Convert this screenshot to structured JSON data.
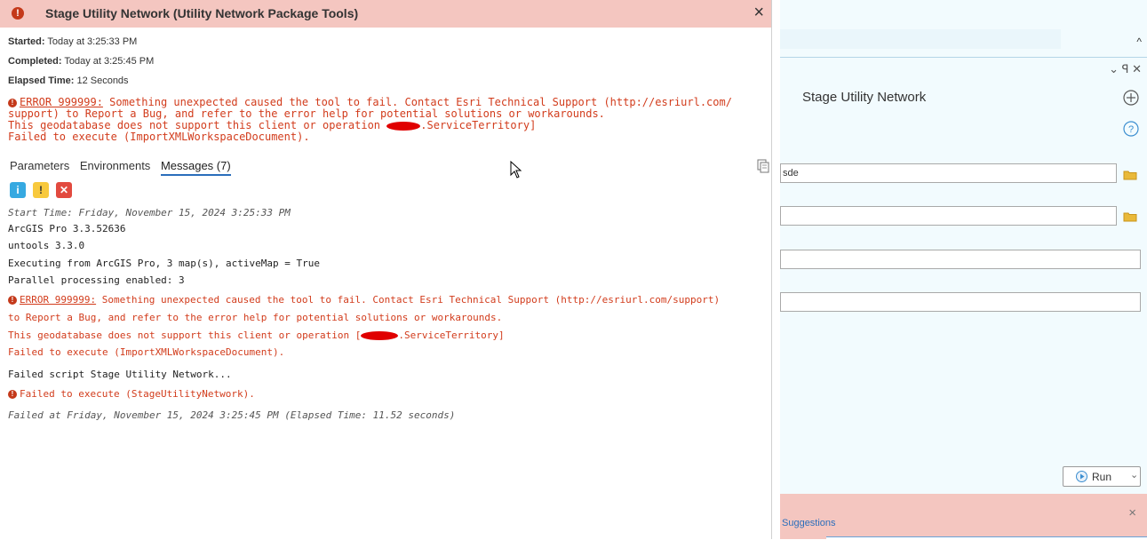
{
  "popup": {
    "title": "Stage Utility Network (Utility Network Package Tools)",
    "close": "×",
    "started_label": "Started:",
    "started_value": "Today at 3:25:33 PM",
    "completed_label": "Completed:",
    "completed_value": "Today at 3:25:45 PM",
    "elapsed_label": "Elapsed Time:",
    "elapsed_value": "12 Seconds",
    "summary_error": {
      "code": "ERROR 999999:",
      "line1": "Something unexpected caused the tool to fail. Contact Esri Technical Support (http://esriurl.com/",
      "line2": "support) to Report a Bug, and refer to the error help for potential solutions or workarounds.",
      "line3_pre": "This geodatabase does not support this client or operation ",
      "line3_post": ".ServiceTerritory]",
      "line4": "Failed to execute (ImportXMLWorkspaceDocument)."
    },
    "tabs": [
      "Parameters",
      "Environments",
      "Messages (7)"
    ],
    "messages": {
      "start_time": "Start Time: Friday, November 15, 2024 3:25:33 PM",
      "version": "ArcGIS Pro 3.3.52636",
      "untools": "untools 3.3.0",
      "executing": "Executing from ArcGIS Pro, 3 map(s), activeMap = True",
      "parallel": "Parallel processing enabled: 3",
      "error_code": "ERROR 999999:",
      "error_line1": "Something unexpected caused the tool to fail. Contact Esri Technical Support (http://esriurl.com/support)",
      "error_line2": "to Report a Bug, and refer to the error help for potential solutions or workarounds.",
      "error_line3_pre": "This geodatabase does not support this client or operation [",
      "error_line3_post": ".ServiceTerritory]",
      "error_line4": "Failed to execute (ImportXMLWorkspaceDocument).",
      "failed_script": "Failed script Stage Utility Network...",
      "failed_exec": "Failed to execute (StageUtilityNetwork).",
      "failed_at": "Failed at Friday, November 15, 2024 3:25:45 PM (Elapsed Time: 11.52 seconds)"
    }
  },
  "pane": {
    "title": "Stage Utility Network",
    "up_chevron": "^",
    "controls": "⌄ ꟼ ✕",
    "field1_value": "sde",
    "run_label": "Run",
    "suggestions_label": "Suggestions",
    "suggest_close": "×"
  },
  "colors": {
    "error_red": "#d23c1c",
    "header_pink": "#f4c6c0",
    "accent_blue": "#2a6ebb"
  }
}
